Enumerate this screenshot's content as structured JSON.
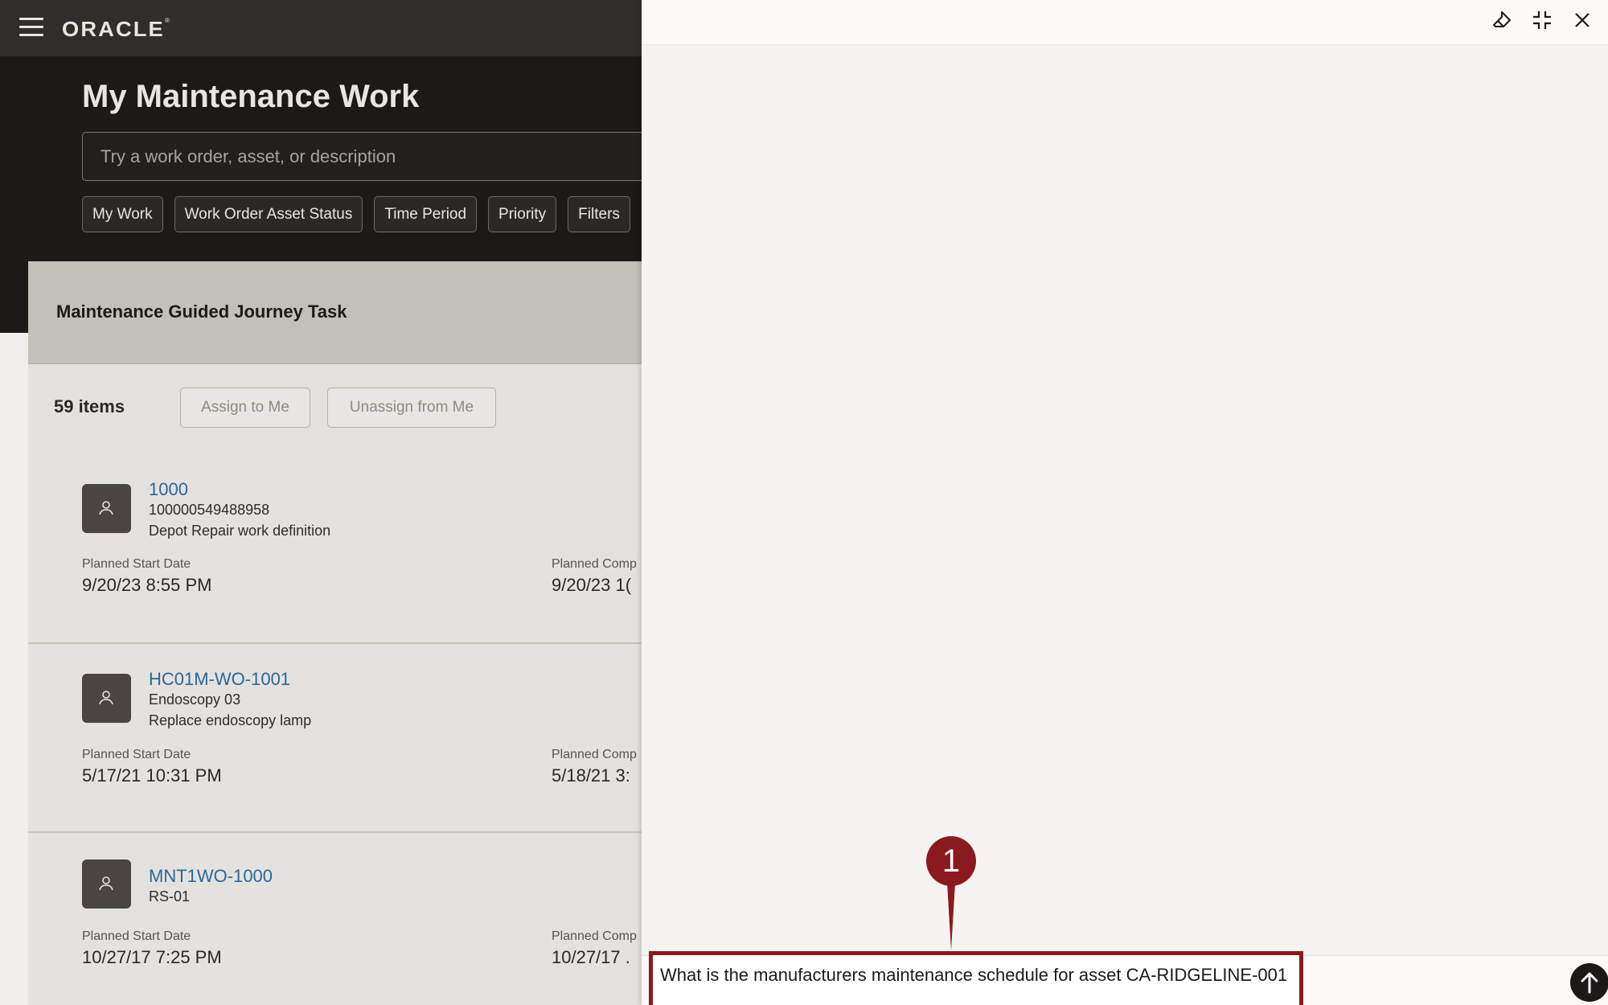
{
  "header": {
    "logo_text": "ORACLE",
    "logo_mark": "®"
  },
  "page": {
    "title": "My Maintenance Work",
    "search_placeholder": "Try a work order, asset, or description"
  },
  "filters": [
    "My Work",
    "Work Order Asset Status",
    "Time Period",
    "Priority",
    "Filters"
  ],
  "guided_journey": {
    "title": "Maintenance Guided Journey Task"
  },
  "toolbar": {
    "count": "59 items",
    "assign_label": "Assign to Me",
    "unassign_label": "Unassign from Me"
  },
  "work_orders": [
    {
      "number": "1000",
      "line1": "100000549488958",
      "line2": "Depot Repair work definition",
      "start_label": "Planned Start Date",
      "start_value": "9/20/23 8:55 PM",
      "comp_label": "Planned Comp",
      "comp_value": "9/20/23 1("
    },
    {
      "number": "HC01M-WO-1001",
      "line1": "Endoscopy 03",
      "line2": "Replace endoscopy lamp",
      "start_label": "Planned Start Date",
      "start_value": "5/17/21 10:31 PM",
      "comp_label": "Planned Comp",
      "comp_value": "5/18/21 3:"
    },
    {
      "number": "MNT1WO-1000",
      "line1": "RS-01",
      "line2": "",
      "start_label": "Planned Start Date",
      "start_value": "10/27/17 7:25 PM",
      "comp_label": "Planned Comp",
      "comp_value": "10/27/17 ."
    }
  ],
  "drawer": {
    "callout_number": "1",
    "prompt": "What is the manufacturers maintenance schedule for asset CA-RIDGELINE-001",
    "icons": [
      "eraser-icon",
      "collapse-icon",
      "close-icon",
      "send-arrow-icon"
    ],
    "accent_color": "#8b1a1f"
  }
}
